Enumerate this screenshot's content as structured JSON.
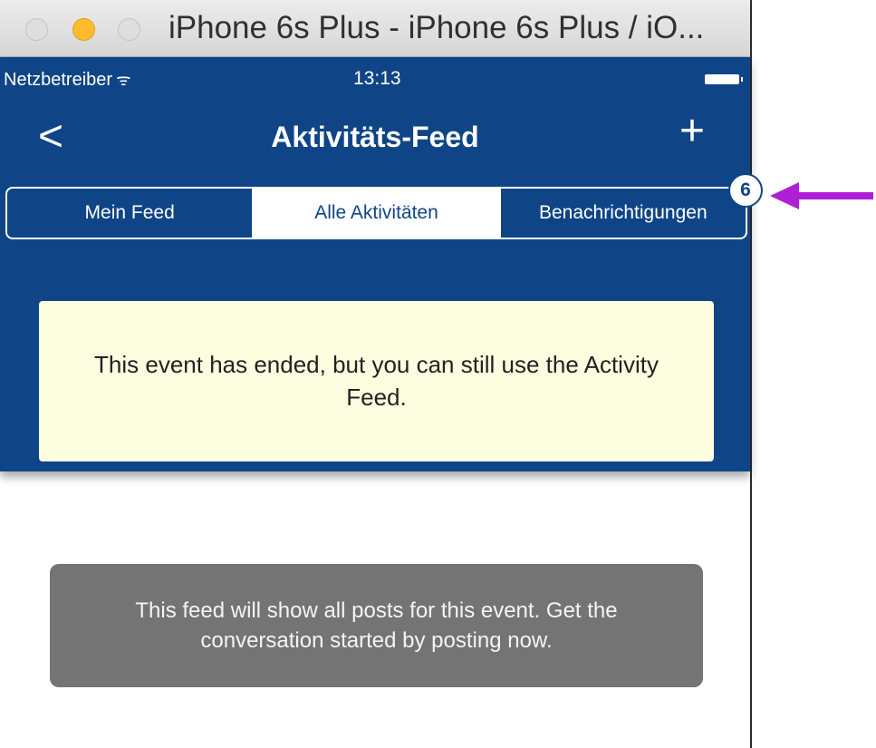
{
  "window": {
    "title": "iPhone 6s Plus - iPhone 6s Plus / iO..."
  },
  "status_bar": {
    "carrier": "Netzbetreiber",
    "wifi_icon": "wifi-icon",
    "time": "13:13",
    "battery_icon": "battery-icon"
  },
  "nav": {
    "back_icon": "chevron-left-icon",
    "back_glyph": "<",
    "title": "Aktivitäts-Feed",
    "add_icon": "plus-icon",
    "add_glyph": "+"
  },
  "segments": [
    {
      "label": "Mein Feed",
      "active": false
    },
    {
      "label": "Alle Aktivitäten",
      "active": true
    },
    {
      "label": "Benachrichtigungen",
      "active": false
    }
  ],
  "notification_badge": "6",
  "notice": {
    "text": "This event has ended, but you can still use the Activity Feed."
  },
  "empty_feed": {
    "text": "This feed will show all posts for this event. Get the conversation started by posting now."
  },
  "annotation": {
    "arrow_color": "#b01fd8",
    "arrow_icon": "arrow-left-icon"
  },
  "colors": {
    "nav_blue": "#0f4586",
    "notice_bg": "#fdfde0",
    "empty_bg": "#747474"
  }
}
